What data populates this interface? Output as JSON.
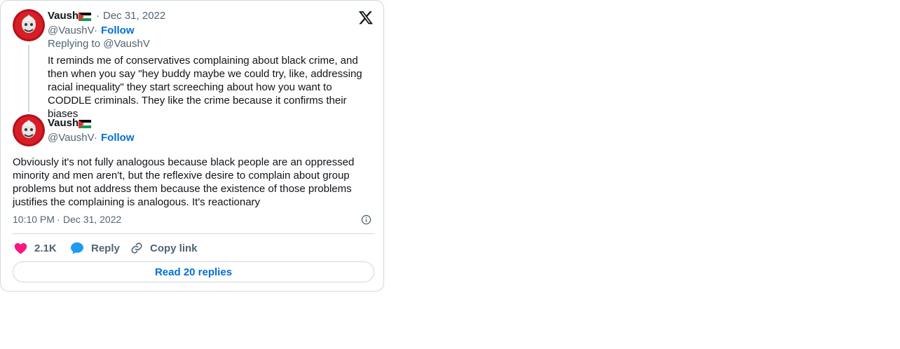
{
  "header": {
    "logo_icon": "x-logo-icon"
  },
  "parent_tweet": {
    "author_name": "Vaush",
    "flag_icon": "palestine-flag-icon",
    "separator": "·",
    "date": "Dec 31, 2022",
    "handle": "@VaushV",
    "follow_label": "Follow",
    "replying_to": "Replying to @VaushV",
    "text": "It reminds me of conservatives complaining about black crime, and then when you say \"hey buddy maybe we could try, like, addressing racial inequality\" they start screeching about how you want to CODDLE criminals. They like the crime because it confirms their biases"
  },
  "main_tweet": {
    "author_name": "Vaush",
    "flag_icon": "palestine-flag-icon",
    "handle": "@VaushV",
    "separator": "·",
    "follow_label": "Follow",
    "text": "Obviously it's not fully analogous because black people are an oppressed minority and men aren't, but the reflexive desire to complain about group problems but not address them because the existence of those problems justifies the complaining is analogous. It's reactionary",
    "time": "10:10 PM",
    "date": "Dec 31, 2022",
    "info_icon": "info-icon"
  },
  "actions": {
    "like_count": "2.1K",
    "reply_label": "Reply",
    "copy_link_label": "Copy link"
  },
  "read_replies_label": "Read 20 replies",
  "colors": {
    "like": "#f91880",
    "reply": "#1d9bf0",
    "link": "#006fd6",
    "muted": "#536471",
    "border": "#cfd9de"
  }
}
